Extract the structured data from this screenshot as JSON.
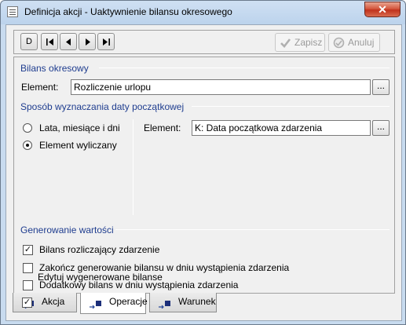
{
  "window": {
    "title": "Definicja akcji - Uaktywnienie bilansu okresowego",
    "close_glyph": "✕"
  },
  "toolbar": {
    "nav_new": "D",
    "save_label": "Zapisz",
    "cancel_label": "Anuluj"
  },
  "bilans": {
    "group_title": "Bilans okresowy",
    "element_label": "Element:",
    "element_value": "Rozliczenie urlopu",
    "browse_label": "..."
  },
  "start_date": {
    "group_title": "Sposób wyznaczania daty początkowej",
    "options": [
      {
        "label": "Lata, miesiące i dni",
        "checked": false
      },
      {
        "label": "Element wyliczany",
        "checked": true
      }
    ],
    "element_label": "Element:",
    "element_value": "K: Data początkowa zdarzenia",
    "browse_label": "..."
  },
  "generation": {
    "group_title": "Generowanie wartości",
    "checkboxes": [
      {
        "label": "Bilans rozliczający zdarzenie",
        "checked": true,
        "mark": "✓"
      },
      {
        "label": "Zakończ generowanie bilansu w dniu wystąpienia zdarzenia",
        "checked": false,
        "mark": ""
      },
      {
        "label": "Dodatkowy bilans w dniu wystąpienia zdarzenia",
        "checked": false,
        "mark": ""
      },
      {
        "label": "Edytuj wygenerowane bilanse",
        "checked": true,
        "mark": "✓"
      }
    ]
  },
  "tabs": [
    {
      "label": "Akcja",
      "active": false
    },
    {
      "label": "Operacje",
      "active": true
    },
    {
      "label": "Warunek",
      "active": false
    }
  ],
  "colors": {
    "group_title": "#1f3d8f",
    "disabled_text": "#9a9a9a",
    "close_button": "#c0321c"
  }
}
